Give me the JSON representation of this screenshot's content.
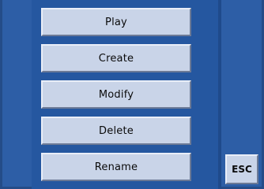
{
  "menu": {
    "items": [
      {
        "label": "Play"
      },
      {
        "label": "Create"
      },
      {
        "label": "Modify"
      },
      {
        "label": "Delete"
      },
      {
        "label": "Rename"
      }
    ]
  },
  "esc_button": {
    "label": "ESC"
  },
  "colors": {
    "background": "#2d5ea6",
    "panel": "#2557a0",
    "button_face": "#c9d4e8",
    "text": "#0a0a0a"
  }
}
